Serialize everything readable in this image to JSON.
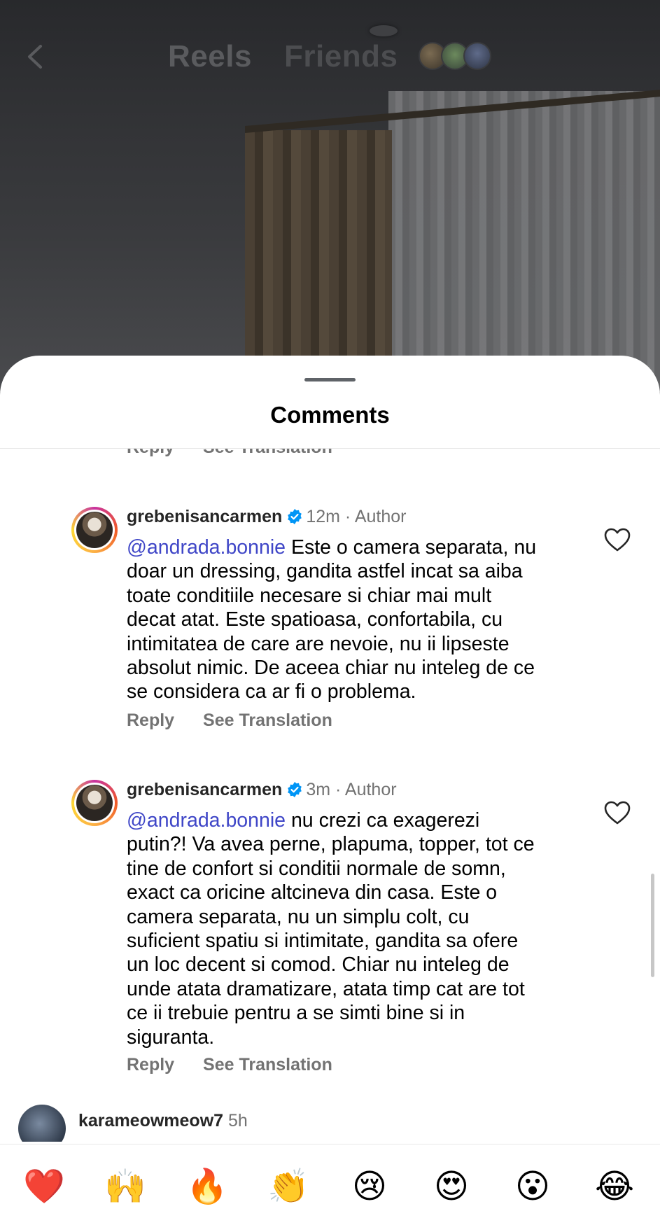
{
  "header": {
    "tabs": [
      "Reels",
      "Friends"
    ],
    "back_icon": "chevron-left-icon"
  },
  "sheet": {
    "title": "Comments"
  },
  "partial_actions": {
    "reply": "Reply",
    "see_translation": "See Translation"
  },
  "comments": [
    {
      "username": "grebenisancarmen",
      "verified": true,
      "time": "12m",
      "tag": "Author",
      "mention": "@andrada.bonnie",
      "lines": [
        " Este o camera separata, nu",
        "doar un dressing, gandita astfel incat sa aiba",
        "toate conditiile necesare si chiar mai mult",
        "decat atat. Este spatioasa, confortabila, cu",
        "intimitatea de care are nevoie, nu ii lipseste",
        "absolut nimic. De aceea chiar nu inteleg de ce",
        "se considera ca ar fi o problema."
      ],
      "reply": "Reply",
      "see_translation": "See Translation"
    },
    {
      "username": "grebenisancarmen",
      "verified": true,
      "time": "3m",
      "tag": "Author",
      "mention": "@andrada.bonnie",
      "lines": [
        " nu crezi ca exagerezi",
        "putin?! Va avea perne, plapuma, topper, tot ce",
        "tine de confort si conditii normale de somn,",
        "exact ca oricine altcineva din casa. Este o",
        "camera separata, nu un simplu colt, cu",
        "suficient spatiu si intimitate, gandita sa ofere",
        "un loc decent si comod. Chiar nu inteleg de",
        "unde atata dramatizare, atata timp cat are tot",
        "ce ii trebuie pentru a se simti bine si in",
        "siguranta."
      ],
      "reply": "Reply",
      "see_translation": "See Translation"
    },
    {
      "username": "karameowmeow7",
      "time": "5h"
    }
  ],
  "emoji_bar": [
    {
      "name": "red-heart",
      "glyph": "❤️"
    },
    {
      "name": "raising-hands",
      "glyph": "🙌"
    },
    {
      "name": "fire",
      "glyph": "🔥"
    },
    {
      "name": "clapping-hands",
      "glyph": "👏"
    },
    {
      "name": "crying-face",
      "glyph": "😢"
    },
    {
      "name": "heart-eyes",
      "glyph": "😍"
    },
    {
      "name": "surprised-face",
      "glyph": "😮"
    },
    {
      "name": "tears-of-joy",
      "glyph": "😂"
    }
  ],
  "colors": {
    "mention": "#3f46c7",
    "verified": "#0095f6",
    "secondary_text": "#737373"
  }
}
